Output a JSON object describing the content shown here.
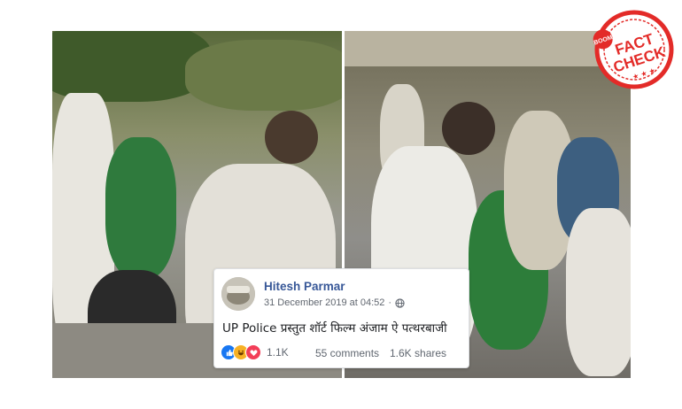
{
  "watermark": {
    "brand": "BOOM",
    "label_line1": "FACT",
    "label_line2": "CHECK",
    "color": "#e32b28"
  },
  "video_frames": [
    {
      "scene": "left-frame"
    },
    {
      "scene": "right-frame"
    }
  ],
  "post": {
    "author": "Hitesh Parmar",
    "timestamp": "31 December 2019 at 04:52",
    "separator": "·",
    "privacy_icon": "globe-icon",
    "text": "UP Police प्रस्तुत शॉर्ट फिल्म अंजाम ऐ पत्थरबाजी",
    "reactions": {
      "icons": [
        "like-icon",
        "haha-icon",
        "love-icon"
      ],
      "count": "1.1K"
    },
    "comments": "55 comments",
    "shares": "1.6K shares",
    "link_color": "#385898"
  }
}
